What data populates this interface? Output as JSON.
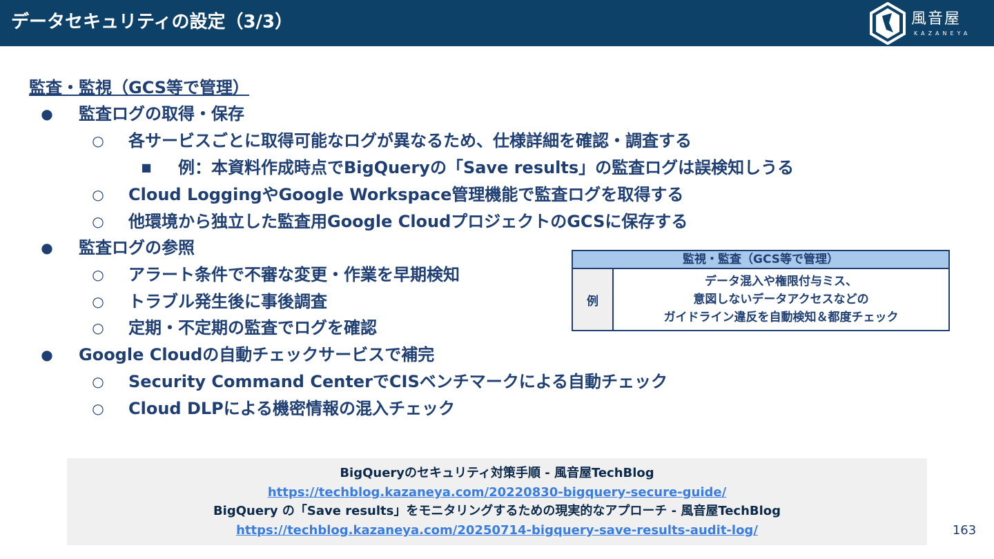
{
  "header": {
    "title": "データセキュリティの設定（3/3）",
    "logo": {
      "name": "風音屋",
      "sub": "KAZANEYA",
      "icon": "kazaneya-logo-icon"
    }
  },
  "section": {
    "heading": "監査・監視（GCS等で管理）",
    "items": [
      {
        "level": 1,
        "marker": "●",
        "text": "監査ログの取得・保存"
      },
      {
        "level": 2,
        "marker": "○",
        "text": "各サービスごとに取得可能なログが異なるため、仕様詳細を確認・調査する"
      },
      {
        "level": 3,
        "marker": "■",
        "text": "例：本資料作成時点でBigQueryの「Save results」の監査ログは誤検知しうる"
      },
      {
        "level": 2,
        "marker": "○",
        "text": "Cloud LoggingやGoogle Workspace管理機能で監査ログを取得する"
      },
      {
        "level": 2,
        "marker": "○",
        "text": "他環境から独立した監査用Google CloudプロジェクトのGCSに保存する"
      },
      {
        "level": 1,
        "marker": "●",
        "text": "監査ログの参照"
      },
      {
        "level": 2,
        "marker": "○",
        "text": "アラート条件で不審な変更・作業を早期検知"
      },
      {
        "level": 2,
        "marker": "○",
        "text": "トラブル発生後に事後調査"
      },
      {
        "level": 2,
        "marker": "○",
        "text": "定期・不定期の監査でログを確認"
      },
      {
        "level": 1,
        "marker": "●",
        "text": "Google Cloudの自動チェックサービスで補完"
      },
      {
        "level": 2,
        "marker": "○",
        "text": "Security Command CenterでCISベンチマークによる自動チェック"
      },
      {
        "level": 2,
        "marker": "○",
        "text": "Cloud DLPによる機密情報の混入チェック"
      }
    ]
  },
  "side_table": {
    "header": "監視・監査（GCS等で管理）",
    "row_label": "例",
    "lines": [
      "データ混入や権限付与ミス、",
      "意図しないデータアクセスなどの",
      "ガイドライン違反を自動検知＆都度チェック"
    ]
  },
  "references": {
    "ref1_title": "BigQueryのセキュリティ対策手順 - 風音屋TechBlog",
    "ref1_url": "https://techblog.kazaneya.com/20220830-bigquery-secure-guide/",
    "ref2_title": "BigQuery の「Save results」をモニタリングするための現実的なアプローチ - 風音屋TechBlog",
    "ref2_url": "https://techblog.kazaneya.com/20250714-bigquery-save-results-audit-log/"
  },
  "page_number": "163",
  "colors": {
    "header_bg": "#0e4168",
    "text": "#1f3f73",
    "table_header": "#a8c8ec",
    "link": "#3a7de0"
  }
}
